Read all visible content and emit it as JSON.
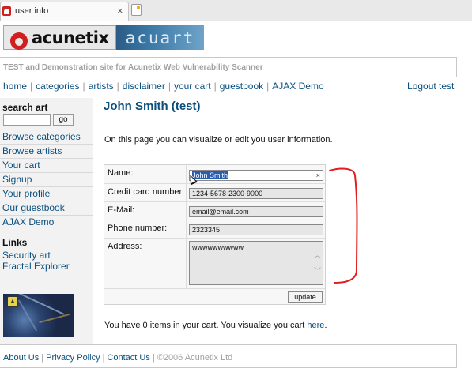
{
  "browser": {
    "tab_title": "user info",
    "tab_close": "×"
  },
  "logo": {
    "left_text": "acunetix",
    "right_text": "acuart"
  },
  "tagline": "TEST and Demonstration site for Acunetix Web Vulnerability Scanner",
  "nav": {
    "items": [
      "home",
      "categories",
      "artists",
      "disclaimer",
      "your cart",
      "guestbook",
      "AJAX Demo"
    ],
    "logout": "Logout test"
  },
  "sidebar": {
    "search_title": "search art",
    "search_placeholder": "",
    "go_label": "go",
    "items": [
      "Browse categories",
      "Browse artists",
      "Your cart",
      "Signup",
      "Your profile",
      "Our guestbook",
      "AJAX Demo"
    ],
    "links_title": "Links",
    "links": [
      "Security art",
      "Fractal Explorer"
    ]
  },
  "main": {
    "title": "John Smith (test)",
    "intro": "On this page you can visualize or edit you user information.",
    "form": {
      "name_label": "Name:",
      "name_value": "John Smith",
      "cc_label": "Credit card number:",
      "cc_value": "1234-5678-2300-9000",
      "email_label": "E-Mail:",
      "email_value": "email@email.com",
      "phone_label": "Phone number:",
      "phone_value": "2323345",
      "address_label": "Address:",
      "address_value": "wwwwwwwwww",
      "update_label": "update",
      "clear_icon": "×"
    },
    "cart_text": "You have 0 items in your cart. You visualize you cart ",
    "cart_link": "here",
    "cart_period": "."
  },
  "footer": {
    "links": [
      "About Us",
      "Privacy Policy",
      "Contact Us"
    ],
    "copyright": "©2006 Acunetix Ltd"
  },
  "colors": {
    "link": "#0a4f7e",
    "annotation": "#e02020",
    "logo_red": "#d21e1e"
  }
}
